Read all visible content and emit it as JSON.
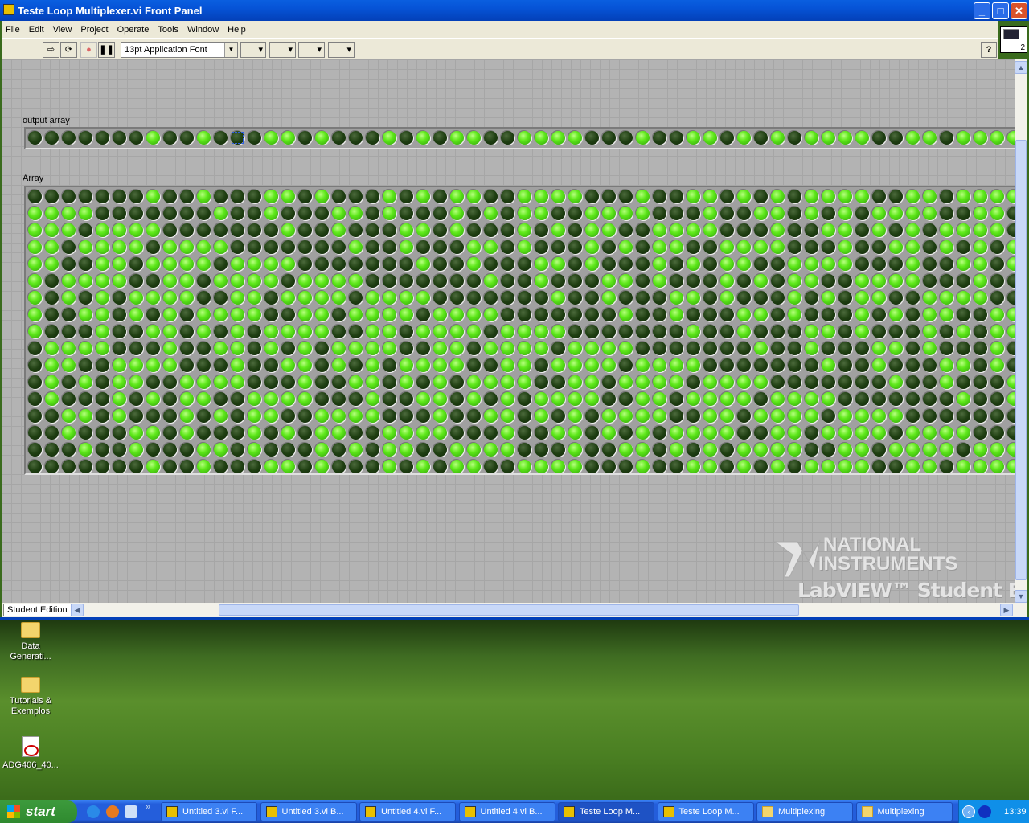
{
  "window": {
    "title": "Teste Loop Multiplexer.vi Front Panel",
    "minimize": "_",
    "maximize": "□",
    "close": "✕"
  },
  "menu": [
    "File",
    "Edit",
    "View",
    "Project",
    "Operate",
    "Tools",
    "Window",
    "Help"
  ],
  "toolbar": {
    "run": "⇨",
    "run_continuous": "⟳",
    "abort": "●",
    "pause": "❚❚",
    "font": "13pt Application Font",
    "dropdown": "▼",
    "align": "▾",
    "distribute": "▾",
    "resize": "▾",
    "reorder": "▾",
    "help": "?",
    "vi_icon_number": "2"
  },
  "panel": {
    "output_label": "output array",
    "array_label": "Array",
    "student_edition": "Student Edition",
    "logo": {
      "line1": "NATIONAL",
      "line2": "INSTRUMENTS",
      "line3": "LabVIEW™ Student Edition"
    },
    "output_array": "00000001001000110100010101100111100010011010101111001101111",
    "array_rows": [
      "00000001001000110100010101100111100010011010101111001101111",
      "11110000000100100011010001010110011110001001101010111100110",
      "11101111000000010010001101000101011001111000100110101011110",
      "11011110111100000001001000110100010101100111100010011010101",
      "11001101111011110000000100100011010001010110011110001001101",
      "10111100110111101111000000010010001101000101011001111000100",
      "10101011110011011110111100000001001000110100010101100111100",
      "10011010101111001101111011110000000100100011010001010110011",
      "10001001101010111100110111101111000000010010001101000101011",
      "01111000100110101011110011011110111100000001001000110100010",
      "01100111100010011010101111001101111011110000000100100011010",
      "01010110011110001001101010111100110111101111000000010010001",
      "01000101011001111000100110101011110011011110111100000001001",
      "00110100010101100111100010011010101111001101111011110000000",
      "00100011010001010110011110001001101010111100110111101111000",
      "00010010001101000101011001111000100110101011110011011110111",
      "00000001001000110100010101100111100010011010101111001101111"
    ],
    "led_on_color": "#5ee81a",
    "led_off_color": "#1f3f12"
  },
  "desktop": [
    {
      "label": "Data Generati...",
      "icon": "folder-icon"
    },
    {
      "label": "Tutoriais & Exemplos",
      "icon": "folder-icon"
    },
    {
      "label": "ADG406_40...",
      "icon": "pdf-icon"
    }
  ],
  "taskbar": {
    "start": "start",
    "more": "»",
    "tasks": [
      {
        "label": "Untitled 3.vi F...",
        "icon": "labview-icon"
      },
      {
        "label": "Untitled 3.vi B...",
        "icon": "labview-icon"
      },
      {
        "label": "Untitled 4.vi F...",
        "icon": "labview-icon"
      },
      {
        "label": "Untitled 4.vi B...",
        "icon": "labview-icon"
      },
      {
        "label": "Teste Loop M...",
        "icon": "labview-icon",
        "active": true
      },
      {
        "label": "Teste Loop M...",
        "icon": "labview-icon"
      },
      {
        "label": "Multiplexing",
        "icon": "folder-icon"
      },
      {
        "label": "Multiplexing",
        "icon": "folder-icon"
      }
    ],
    "clock": "13:39"
  }
}
